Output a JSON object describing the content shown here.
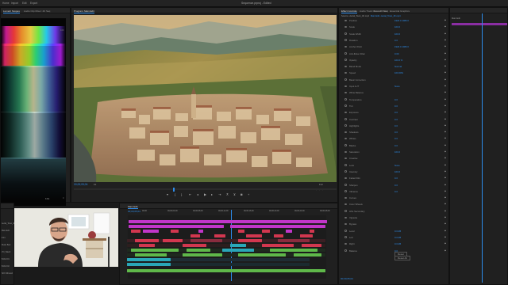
{
  "app": {
    "title": "Sequence.prproj - Edited",
    "nav": [
      "Home",
      "Import",
      "Edit",
      "Export"
    ]
  },
  "left_panel": {
    "tabs": [
      "Lumetri Scopes",
      "Audio Clip Mixer: 4K Seq"
    ],
    "scale_top": "100",
    "scale_bottom": "0",
    "footer": "8 Bit"
  },
  "program_monitor": {
    "tab": "Program: Main Edit",
    "timecode_in": "00;00;05;04",
    "fit": "Fit",
    "quality": "Full",
    "timecode_out": "00;00;17;20"
  },
  "effect_controls": {
    "tabs": [
      "Effect Controls",
      "Audio Track Mixer: 4K Seq",
      "Lumetri Color",
      "Essential Graphics"
    ],
    "source_label": "Source • Aerial_Town_4K.mp4",
    "sequence_label": "Main Edit • Aerial_Town_4K.mp4",
    "sections": [
      "Video",
      "Motion",
      "Opacity",
      "Time Remapping",
      "Lumetri Color",
      "Audio",
      "Volume",
      "Channel Volume",
      "Panner"
    ],
    "properties": [
      {
        "label": "Position",
        "value": "1920.0   1080.0"
      },
      {
        "label": "Scale",
        "value": "100.0"
      },
      {
        "label": "Scale Width",
        "value": "100.0"
      },
      {
        "label": "Rotation",
        "value": "0.0"
      },
      {
        "label": "Anchor Point",
        "value": "1920.0   1080.0"
      },
      {
        "label": "Anti-flicker Filter",
        "value": "0.00"
      },
      {
        "label": "Opacity",
        "value": "100.0 %"
      },
      {
        "label": "Blend Mode",
        "value": "Normal"
      },
      {
        "label": "Speed",
        "value": "100.00%"
      },
      {
        "label": "Basic Correction",
        "value": ""
      },
      {
        "label": "Input LUT",
        "value": "None"
      },
      {
        "label": "White Balance",
        "value": ""
      },
      {
        "label": "Temperature",
        "value": "0.0"
      },
      {
        "label": "Tint",
        "value": "0.0"
      },
      {
        "label": "Exposure",
        "value": "0.0"
      },
      {
        "label": "Contrast",
        "value": "0.0"
      },
      {
        "label": "Highlights",
        "value": "0.0"
      },
      {
        "label": "Shadows",
        "value": "0.0"
      },
      {
        "label": "Whites",
        "value": "0.0"
      },
      {
        "label": "Blacks",
        "value": "0.0"
      },
      {
        "label": "Saturation",
        "value": "100.0"
      },
      {
        "label": "Creative",
        "value": ""
      },
      {
        "label": "Look",
        "value": "None"
      },
      {
        "label": "Intensity",
        "value": "100.0"
      },
      {
        "label": "Faded Film",
        "value": "0.0"
      },
      {
        "label": "Sharpen",
        "value": "0.0"
      },
      {
        "label": "Vibrance",
        "value": "0.0"
      },
      {
        "label": "Curves",
        "value": ""
      },
      {
        "label": "Color Wheels",
        "value": ""
      },
      {
        "label": "HSL Secondary",
        "value": ""
      },
      {
        "label": "Vignette",
        "value": ""
      },
      {
        "label": "Bypass",
        "value": ""
      },
      {
        "label": "Level",
        "value": "0.0 dB"
      },
      {
        "label": "Left",
        "value": "0.0 dB"
      },
      {
        "label": "Right",
        "value": "0.0 dB"
      },
      {
        "label": "Balance",
        "value": "0.0"
      }
    ],
    "buttons": [
      "Reset",
      "Reset All"
    ],
    "footer_timecode": "00;00;05;04"
  },
  "timeline_ruler_panel": {
    "header": "Main Edit"
  },
  "timeline": {
    "tab": "Main Edit",
    "timecode": "00;00;05;04",
    "ruler": [
      "00;00",
      "00;00;04;00",
      "00;00;08;00",
      "00;00;12;00",
      "00;00;16;00",
      "00;00;20;00",
      "00;00;24;00",
      "00;00;28;00"
    ]
  },
  "project_panel": {
    "items": [
      "Aerial_Town_4K",
      "Main Edit",
      "Intro",
      "Music Bed",
      "VO_Take3",
      "B-Roll 01",
      "B-Roll 02",
      "SFX Whoosh"
    ]
  },
  "colors": {
    "accent": "#2d8ceb",
    "clip_magenta": "#c136c9",
    "clip_red": "#d2374f",
    "clip_green": "#5fb84a",
    "clip_teal": "#2aa7b8"
  }
}
